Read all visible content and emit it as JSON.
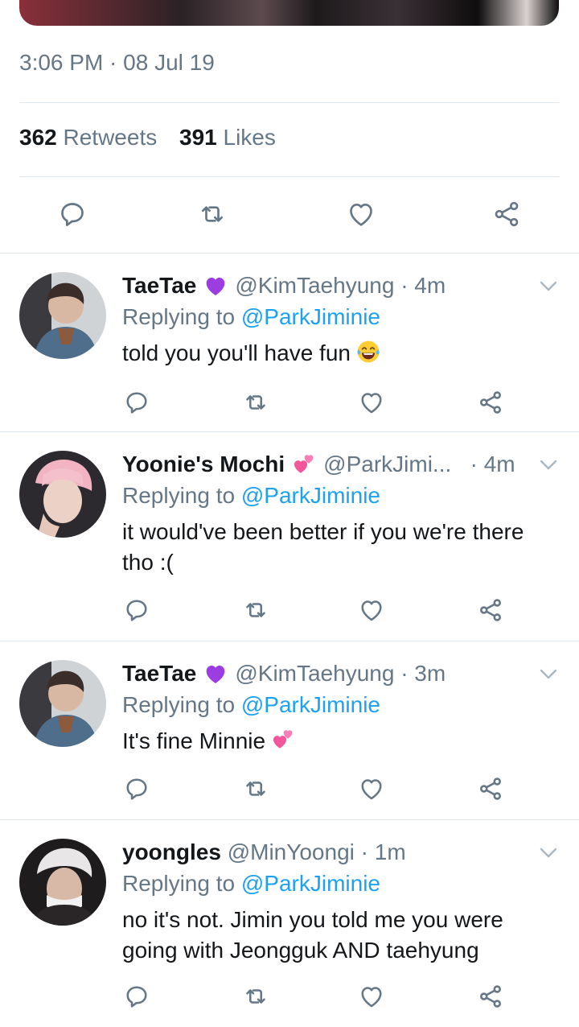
{
  "tweet": {
    "timestamp": "3:06 PM · 08 Jul 19",
    "retweets_count": "362",
    "retweets_label": "Retweets",
    "likes_count": "391",
    "likes_label": "Likes"
  },
  "icons": {
    "reply": "reply-icon",
    "retweet": "retweet-icon",
    "like": "heart-icon",
    "share": "share-icon",
    "chevron": "chevron-down-icon"
  },
  "colors": {
    "mention": "#1da1f2",
    "secondary_text": "#657786",
    "icon": "#657786",
    "divider": "#e1e8ed"
  },
  "replies": [
    {
      "name": "TaeTae",
      "emoji": "purple-heart",
      "handle": "@KimTaehyung",
      "time": "· 4m",
      "replying_prefix": "Replying to",
      "replying_to": "@ParkJiminie",
      "text": "told you you'll have fun",
      "text_emoji": "tears-of-joy"
    },
    {
      "name": "Yoonie's Mochi",
      "emoji": "two-hearts",
      "handle": "@ParkJimi...",
      "time": "· 4m",
      "replying_prefix": "Replying to",
      "replying_to": "@ParkJiminie",
      "text": "it would've been better if you we're there tho :(",
      "text_emoji": ""
    },
    {
      "name": "TaeTae",
      "emoji": "purple-heart",
      "handle": "@KimTaehyung",
      "time": "· 3m",
      "replying_prefix": "Replying to",
      "replying_to": "@ParkJiminie",
      "text": "It's fine Minnie",
      "text_emoji": "two-hearts"
    },
    {
      "name": "yoongles",
      "emoji": "",
      "handle": "@MinYoongi",
      "time": "· 1m",
      "replying_prefix": "Replying to",
      "replying_to": "@ParkJiminie",
      "text": "no it's not. Jimin you told me you were going with Jeongguk AND taehyung",
      "text_emoji": ""
    }
  ]
}
